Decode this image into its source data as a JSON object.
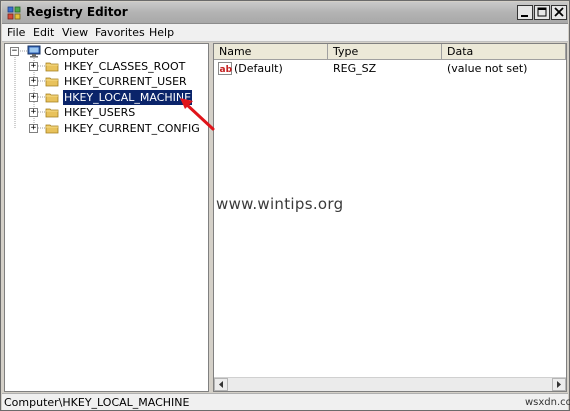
{
  "window": {
    "title": "Registry Editor"
  },
  "menu": [
    "File",
    "Edit",
    "View",
    "Favorites",
    "Help"
  ],
  "tree": {
    "root": "Computer",
    "keys": [
      {
        "label": "HKEY_CLASSES_ROOT"
      },
      {
        "label": "HKEY_CURRENT_USER"
      },
      {
        "label": "HKEY_LOCAL_MACHINE"
      },
      {
        "label": "HKEY_USERS"
      },
      {
        "label": "HKEY_CURRENT_CONFIG"
      }
    ],
    "selected": "HKEY_LOCAL_MACHINE"
  },
  "list": {
    "columns": [
      "Name",
      "Type",
      "Data"
    ],
    "rows": [
      {
        "name": "(Default)",
        "type": "REG_SZ",
        "data": "(value not set)"
      }
    ]
  },
  "status": "Computer\\HKEY_LOCAL_MACHINE",
  "watermark": "www.wintips.org",
  "brand": "wsxdn.com",
  "colors": {
    "selection": "#0a246a",
    "arrow": "#e0141a",
    "folder": "#e8c25c"
  }
}
